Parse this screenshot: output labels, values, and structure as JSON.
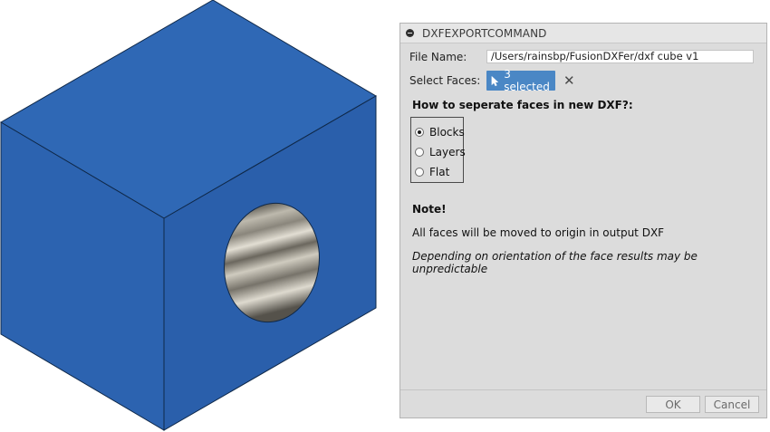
{
  "viewport": {
    "model_name": "cube-with-hole",
    "colors": {
      "top_face": "#2f68b5",
      "left_face": "#2c63b0",
      "right_face": "#2a5fab",
      "edge": "#0f2848"
    }
  },
  "dialog": {
    "title": "DXFEXPORTCOMMAND",
    "file_name": {
      "label": "File Name:",
      "value": "/Users/rainsbp/FusionDXFer/dxf cube v1"
    },
    "select_faces": {
      "label": "Select Faces:",
      "selected_text": "3 selected",
      "clear_icon": "close-icon",
      "accent": "#4a87c5"
    },
    "separation": {
      "heading": "How to seperate faces in new DXF?:",
      "options": [
        {
          "label": "Blocks",
          "checked": true
        },
        {
          "label": "Layers",
          "checked": false
        },
        {
          "label": "Flat",
          "checked": false
        }
      ]
    },
    "note": {
      "heading": "Note!",
      "line1": "All faces will be moved to origin in output DXF",
      "line2": "Depending on orientation of the face results may be unpredictable"
    },
    "buttons": {
      "ok": "OK",
      "cancel": "Cancel"
    }
  }
}
